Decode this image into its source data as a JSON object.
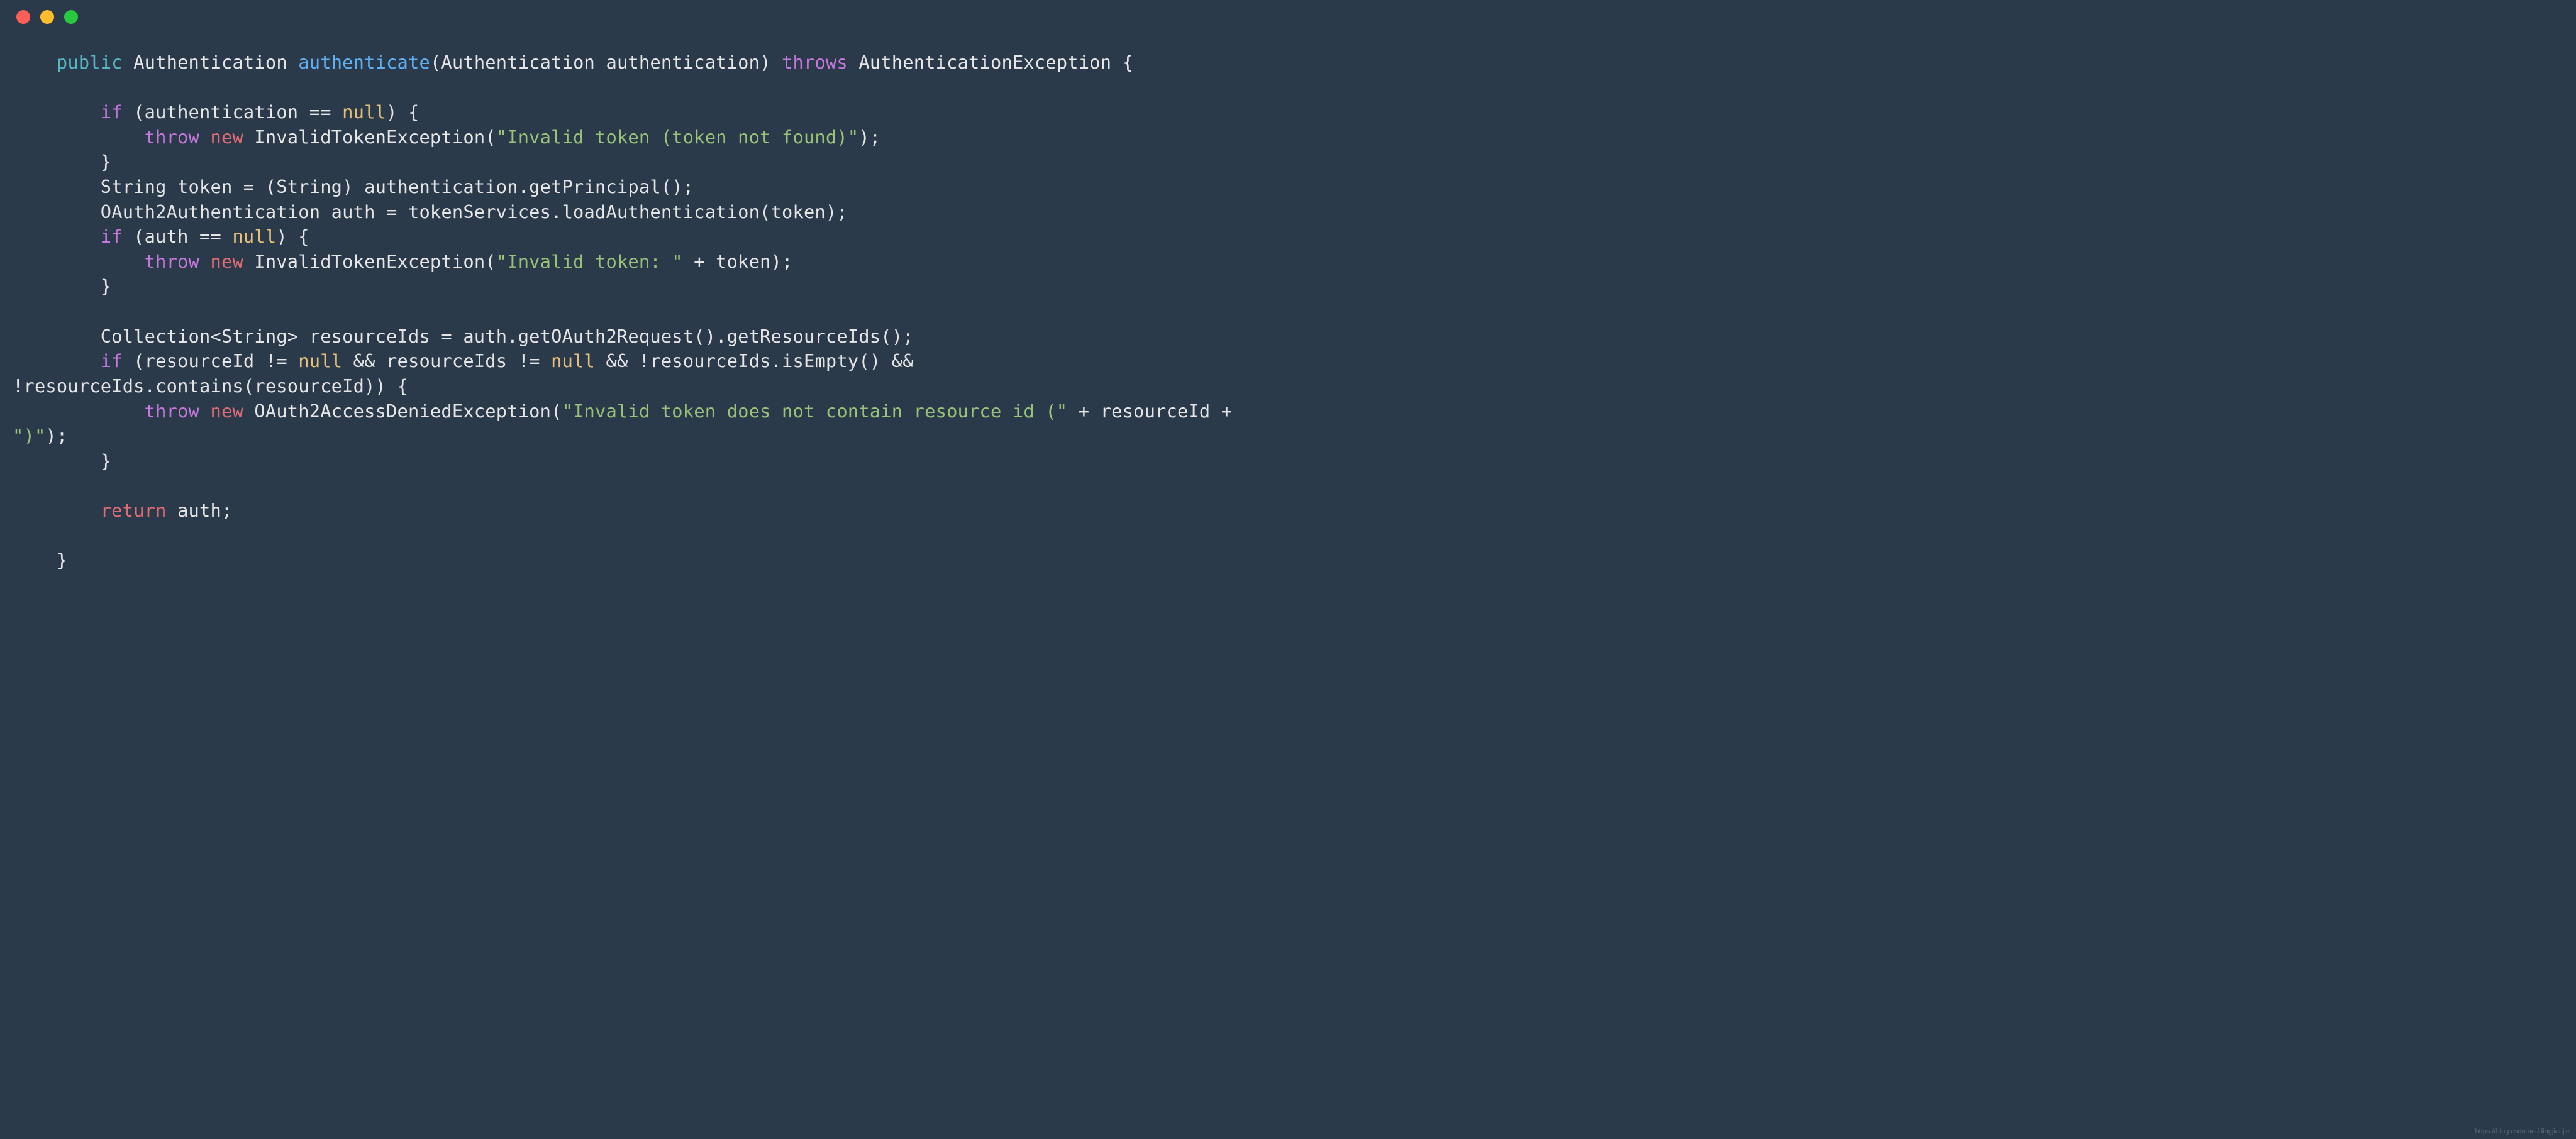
{
  "window": {
    "traffic_lights": {
      "red": "#ff5f56",
      "yellow": "#ffbd2e",
      "green": "#27c93f"
    }
  },
  "watermark": "https://blog.csdn.net/dingjianjie",
  "code": {
    "indent1": "    ",
    "indent2": "        ",
    "indent3": "            ",
    "kw_public": "public",
    "ret_type": "Authentication",
    "fn_name": "authenticate",
    "sig_rest": "(Authentication authentication) ",
    "kw_throws": "throws",
    "exc_type": " AuthenticationException {",
    "blank": "",
    "kw_if": "if",
    "cond1_a": " (authentication == ",
    "kw_null": "null",
    "cond1_b": ") {",
    "kw_throw": "throw",
    "kw_new": "new",
    "exc1": " InvalidTokenException(",
    "str1": "\"Invalid token (token not found)\"",
    "close_paren_semi": ");",
    "close_brace": "}",
    "line_token": "String token = (String) authentication.getPrincipal();",
    "line_auth": "OAuth2Authentication auth = tokenServices.loadAuthentication(token);",
    "cond2_a": " (auth == ",
    "cond2_b": ") {",
    "exc2": " InvalidTokenException(",
    "str2": "\"Invalid token: \"",
    "plus_token": " + token);",
    "line_coll": "Collection<String> resourceIds = auth.getOAuth2Request().getResourceIds();",
    "cond3_a": " (resourceId != ",
    "cond3_b": " && resourceIds != ",
    "cond3_c": " && !resourceIds.isEmpty() && ",
    "cond3_d": "!resourceIds.contains(resourceId)) {",
    "exc3": " OAuth2AccessDeniedException(",
    "str3": "\"Invalid token does not contain resource id (\"",
    "plus_rid": " + resourceId + ",
    "str4": "\")\"",
    "kw_return": "return",
    "ret_tail": " auth;"
  }
}
